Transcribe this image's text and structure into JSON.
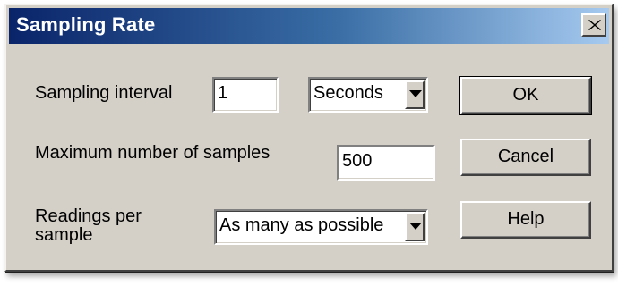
{
  "window": {
    "title": "Sampling Rate",
    "close_symbol": "×"
  },
  "sampling_interval": {
    "label": "Sampling interval",
    "value": "1",
    "unit_selected": "Seconds"
  },
  "max_samples": {
    "label": "Maximum number of samples",
    "value": "500"
  },
  "readings": {
    "label_line1": "Readings per",
    "label_line2": "sample",
    "selected": "As many as possible"
  },
  "buttons": {
    "ok": "OK",
    "cancel": "Cancel",
    "help": "Help"
  },
  "icons": {
    "close": "close-icon",
    "dropdown": "chevron-down-icon"
  },
  "colors": {
    "title_gradient_start": "#0a246a",
    "title_gradient_end": "#a6caf0",
    "face": "#d4d0c8"
  }
}
